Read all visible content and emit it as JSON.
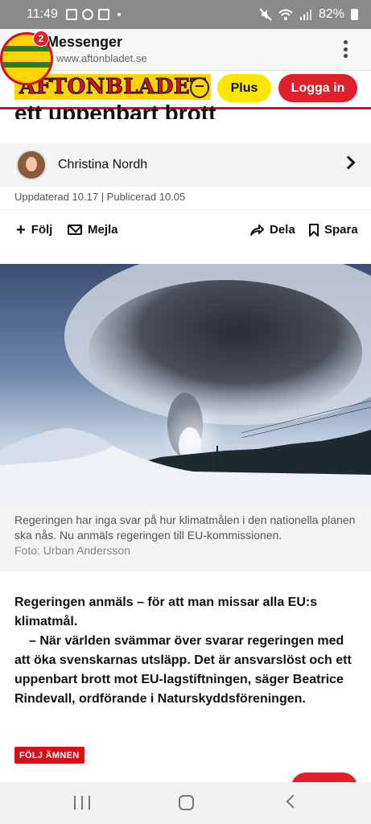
{
  "status_bar": {
    "time": "11:49",
    "battery": "82%"
  },
  "messenger": {
    "title": "Messenger",
    "url": "www.aftonbladet.se",
    "badge_count": "2"
  },
  "site_header": {
    "logo_text": "AFTONBLADET",
    "plus_label": "Plus",
    "login_label": "Logga in"
  },
  "article": {
    "headline_fragment": "ett uppenbart brott",
    "author": "Christina Nordh",
    "dates": "Uppdaterad 10.17 | Publicerad 10.05",
    "actions": {
      "follow": "Följ",
      "email": "Mejla",
      "share": "Dela",
      "save": "Spara"
    },
    "image_caption": "Regeringen har inga svar på hur klimatmålen i den nationella planen ska nås. Nu anmäls regeringen till EU-kommissionen.",
    "photo_credit": "Foto: Urban Andersson",
    "lead_paragraph": "Regeringen anmäls – för att man missar alla EU:s klimatmål.",
    "lead_quote": "– När världen svämmar över svarar regeringen med att öka svenskarnas utsläpp. Det är ansvarslöst och ett uppenbart brott mot EU-lagstiftningen, säger Beatrice Rindevall, ordförande i Naturskyddsföreningen.",
    "follow_topics_label": "FÖLJ ÄMNEN"
  },
  "colors": {
    "brand_red": "#d4101a",
    "brand_yellow": "#ffd400",
    "plus_yellow": "#ffe600"
  },
  "icons": [
    "mute-icon",
    "wifi-icon",
    "signal-icon",
    "battery-icon",
    "more-vert-icon",
    "chevron-right-icon",
    "plus-icon",
    "mail-icon",
    "share-icon",
    "bookmark-icon",
    "recents-icon",
    "home-icon",
    "back-icon"
  ]
}
